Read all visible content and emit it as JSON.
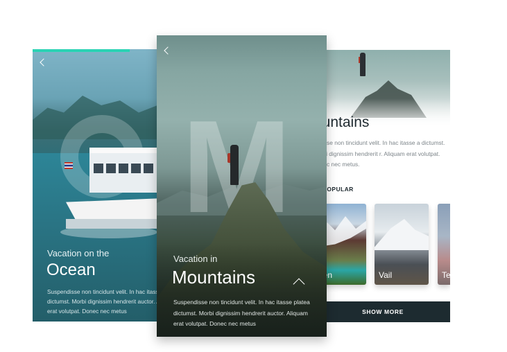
{
  "ocean_card": {
    "subtitle": "Vacation on the",
    "title": "Ocean",
    "body": "Suspendisse non tincidunt velit. In hac itasse platea dictumst. Morbi dignissim hendrerit auctor. Aliquam erat volutpat. Donec nec metus"
  },
  "mountains_card": {
    "subtitle": "Vacation in",
    "title": "Mountains",
    "big_letter": "M",
    "body": "Suspendisse non tincidunt velit. In hac itasse platea dictumst. Morbi dignissim hendrerit auctor. Aliquam erat volutpat. Donec nec metus"
  },
  "list_card": {
    "title": "ountains",
    "body": "endisse non tincidunt velit. In hac itasse a dictumst. Morbi dignissim hendrerit r. Aliquam erat volutpat. Donec nec metus.",
    "section_label": "T POPULAR",
    "thumbnails": [
      {
        "label": "pen"
      },
      {
        "label": "Vail"
      },
      {
        "label": "Te"
      }
    ],
    "show_more_label": "SHOW MORE"
  },
  "colors": {
    "accent": "#2ad3b4",
    "dark_button": "#1d2b30"
  }
}
